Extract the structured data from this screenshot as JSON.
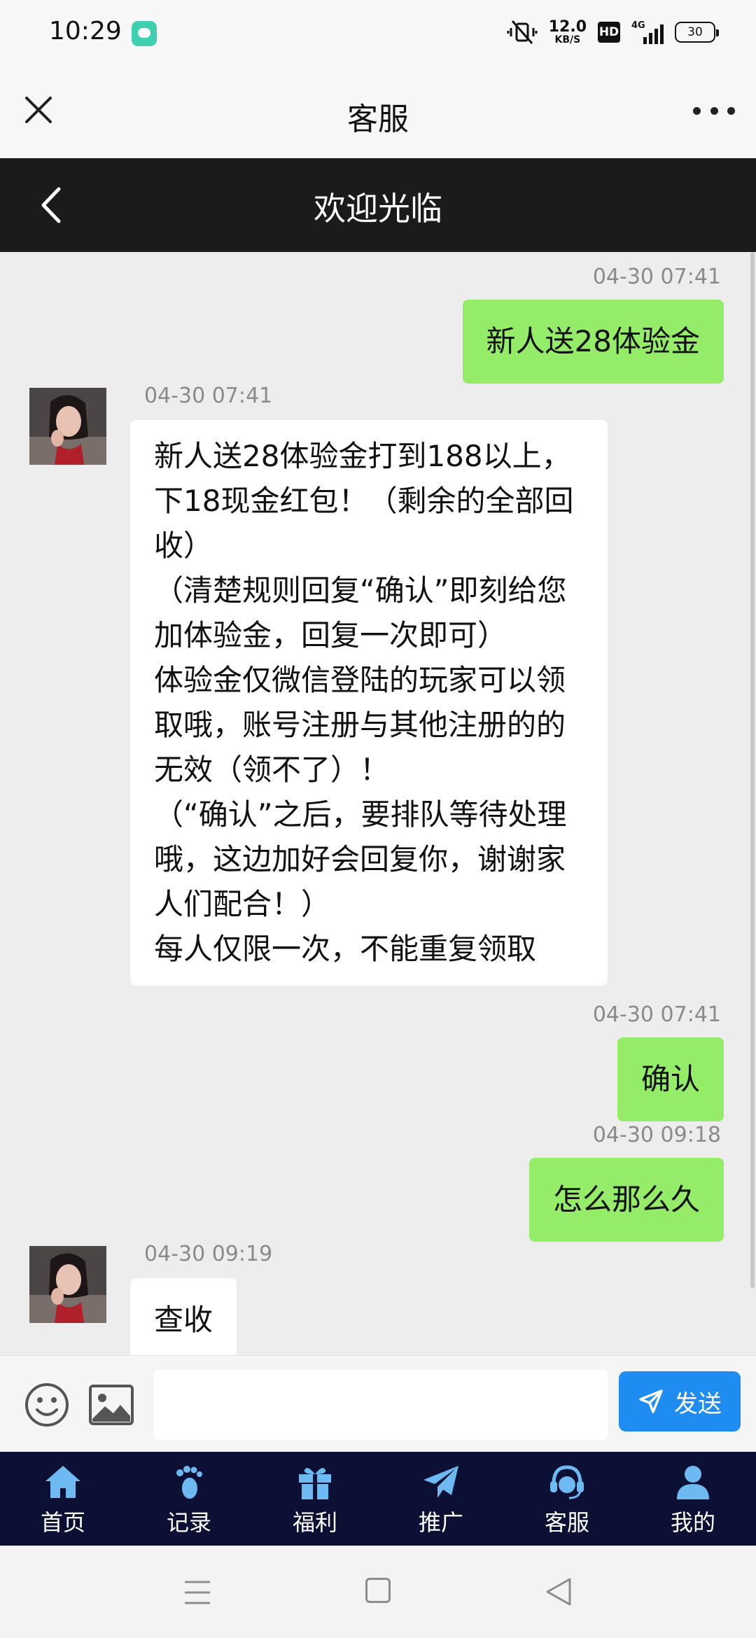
{
  "status_bar": {
    "time": "10:29",
    "net_speed": "12.0",
    "net_unit": "KB/S",
    "hd_label": "HD",
    "network_type": "4G",
    "battery": "30"
  },
  "title_bar": {
    "title": "客服"
  },
  "header": {
    "title": "欢迎光临"
  },
  "messages": [
    {
      "direction": "out",
      "time": "04-30 07:41",
      "lines": [
        "新人送28体验金"
      ]
    },
    {
      "direction": "in",
      "time": "04-30 07:41",
      "lines": [
        "新人送28体验金打到188以上，",
        "下18现金红包！（剩余的全部回",
        "收）",
        "（清楚规则回复“确认”即刻给您",
        "加体验金，回复一次即可）",
        "体验金仅微信登陆的玩家可以领",
        "取哦，账号注册与其他注册的的",
        "无效（领不了）！",
        "（“确认”之后，要排队等待处理",
        "哦，这边加好会回复你，谢谢家",
        "人们配合！）",
        "每人仅限一次，不能重复领取"
      ]
    },
    {
      "direction": "out",
      "time": "04-30 07:41",
      "lines": [
        "确认"
      ]
    },
    {
      "direction": "out",
      "time": "04-30 09:18",
      "lines": [
        "怎么那么久"
      ]
    },
    {
      "direction": "in",
      "time": "04-30 09:19",
      "lines": [
        "查收"
      ]
    }
  ],
  "input_bar": {
    "value": "",
    "send_label": "发送"
  },
  "tabs": [
    {
      "label": "首页",
      "icon": "home-icon"
    },
    {
      "label": "记录",
      "icon": "footprint-icon"
    },
    {
      "label": "福利",
      "icon": "gift-icon"
    },
    {
      "label": "推广",
      "icon": "paper-plane-icon"
    },
    {
      "label": "客服",
      "icon": "headset-icon"
    },
    {
      "label": "我的",
      "icon": "user-icon"
    }
  ],
  "colors": {
    "outgoing_bubble": "#95ec69",
    "incoming_bubble": "#ffffff",
    "header_band": "#1b1b1b",
    "send_button": "#1e8cf0",
    "tab_bar": "#0c1035",
    "tab_icon": "#6db9f2"
  }
}
